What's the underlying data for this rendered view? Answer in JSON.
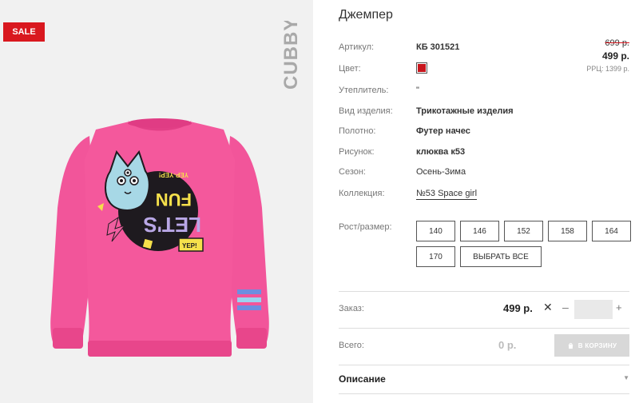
{
  "badge": {
    "sale": "SALE"
  },
  "brand": {
    "name": "CUBBY"
  },
  "product": {
    "title": "Джемпер",
    "print_text": {
      "lets": "LET'S",
      "fun": "FUN",
      "yep": "YEP-YEP!",
      "yep_tag": "YEP!"
    }
  },
  "attributes": [
    {
      "label": "Артикул:",
      "value": "КБ 301521"
    },
    {
      "label": "Цвет:",
      "value": ""
    },
    {
      "label": "Утеплитель:",
      "value": "\""
    },
    {
      "label": "Вид изделия:",
      "value": "Трикотажные изделия"
    },
    {
      "label": "Полотно:",
      "value": "Футер начес"
    },
    {
      "label": "Рисунок:",
      "value": "клюква к53"
    },
    {
      "label": "Сезон:",
      "value": "Осень-Зима"
    },
    {
      "label": "Коллекция:",
      "value": "№53 Space girl"
    }
  ],
  "color_swatch": "#c8161d",
  "price": {
    "old": "699 р.",
    "new": "499 р.",
    "rrp": "РРЦ: 1399 р."
  },
  "sizes": {
    "label": "Рост/размер:",
    "options": [
      "140",
      "146",
      "152",
      "158",
      "164",
      "170"
    ],
    "select_all": "ВЫБРАТЬ ВСЕ"
  },
  "order": {
    "label": "Заказ:",
    "price": "499 р.",
    "times": "✕",
    "minus": "–",
    "quantity": "",
    "plus": "+"
  },
  "total": {
    "label": "Всего:",
    "value": "0 р.",
    "cart_button": "В КОРЗИНУ"
  },
  "description": {
    "title": "Описание",
    "caret": "▼"
  },
  "colors": {
    "accent": "#d9181f",
    "sweater": "#f2559a",
    "panel_bg": "#f1f1f1"
  }
}
